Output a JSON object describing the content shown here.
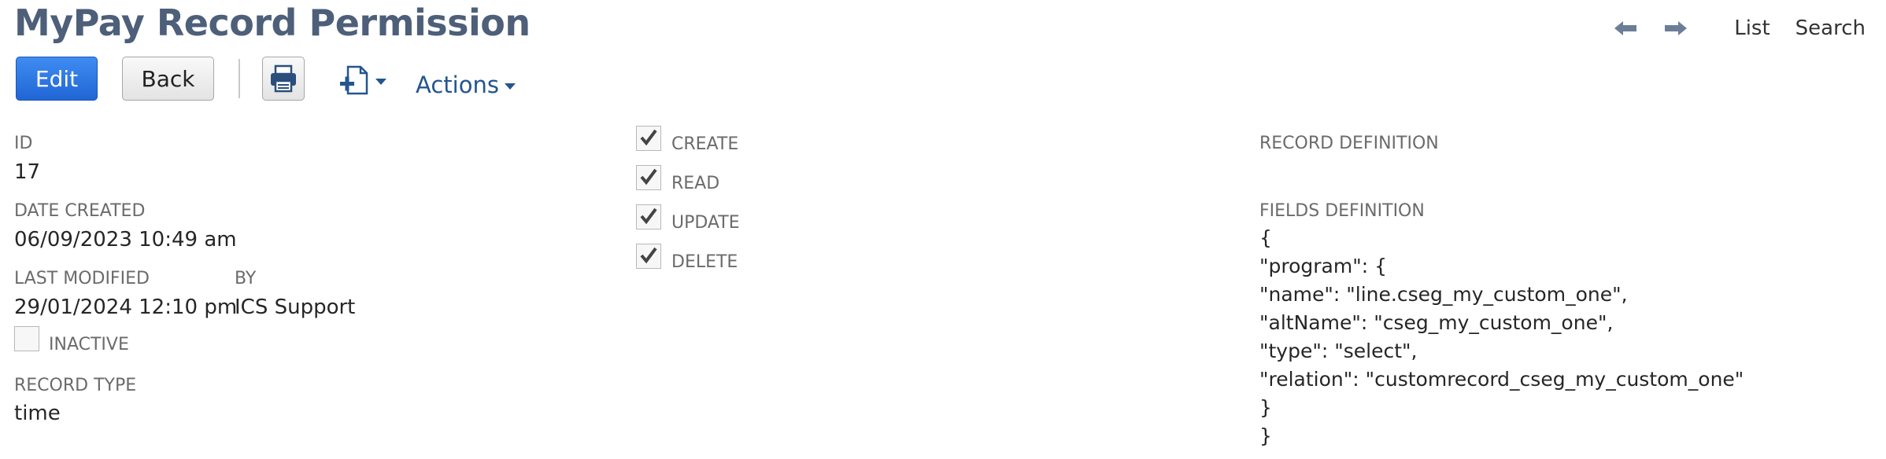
{
  "page": {
    "title": "MyPay Record Permission"
  },
  "nav": {
    "list_label": "List",
    "search_label": "Search"
  },
  "toolbar": {
    "edit_label": "Edit",
    "back_label": "Back",
    "actions_label": "Actions"
  },
  "fields": {
    "id_label": "ID",
    "id_value": "17",
    "date_created_label": "DATE CREATED",
    "date_created_value": "06/09/2023 10:49 am",
    "last_modified_label": "LAST MODIFIED",
    "last_modified_value": "29/01/2024 12:10 pm",
    "by_label": "BY",
    "by_value": "ICS Support",
    "inactive_label": "INACTIVE",
    "inactive_checked": false,
    "record_type_label": "RECORD TYPE",
    "record_type_value": "time"
  },
  "permissions": [
    {
      "label": "CREATE",
      "checked": true
    },
    {
      "label": "READ",
      "checked": true
    },
    {
      "label": "UPDATE",
      "checked": true
    },
    {
      "label": "DELETE",
      "checked": true
    }
  ],
  "definitions": {
    "record_definition_label": "RECORD DEFINITION",
    "fields_definition_label": "FIELDS DEFINITION",
    "fields_definition_lines": [
      "{",
      "\"program\": {",
      "\"name\": \"line.cseg_my_custom_one\",",
      "\"altName\": \"cseg_my_custom_one\",",
      "\"type\": \"select\",",
      "\"relation\": \"customrecord_cseg_my_custom_one\"",
      "}",
      "}"
    ]
  },
  "icons": {
    "prev": "arrow-left-icon",
    "next": "arrow-right-icon",
    "print": "printer-icon",
    "new_record": "new-document-icon",
    "check": "checkmark-icon"
  },
  "colors": {
    "title": "#4d5f79",
    "edit_button": "#2f7ae5",
    "link": "#24558f"
  }
}
